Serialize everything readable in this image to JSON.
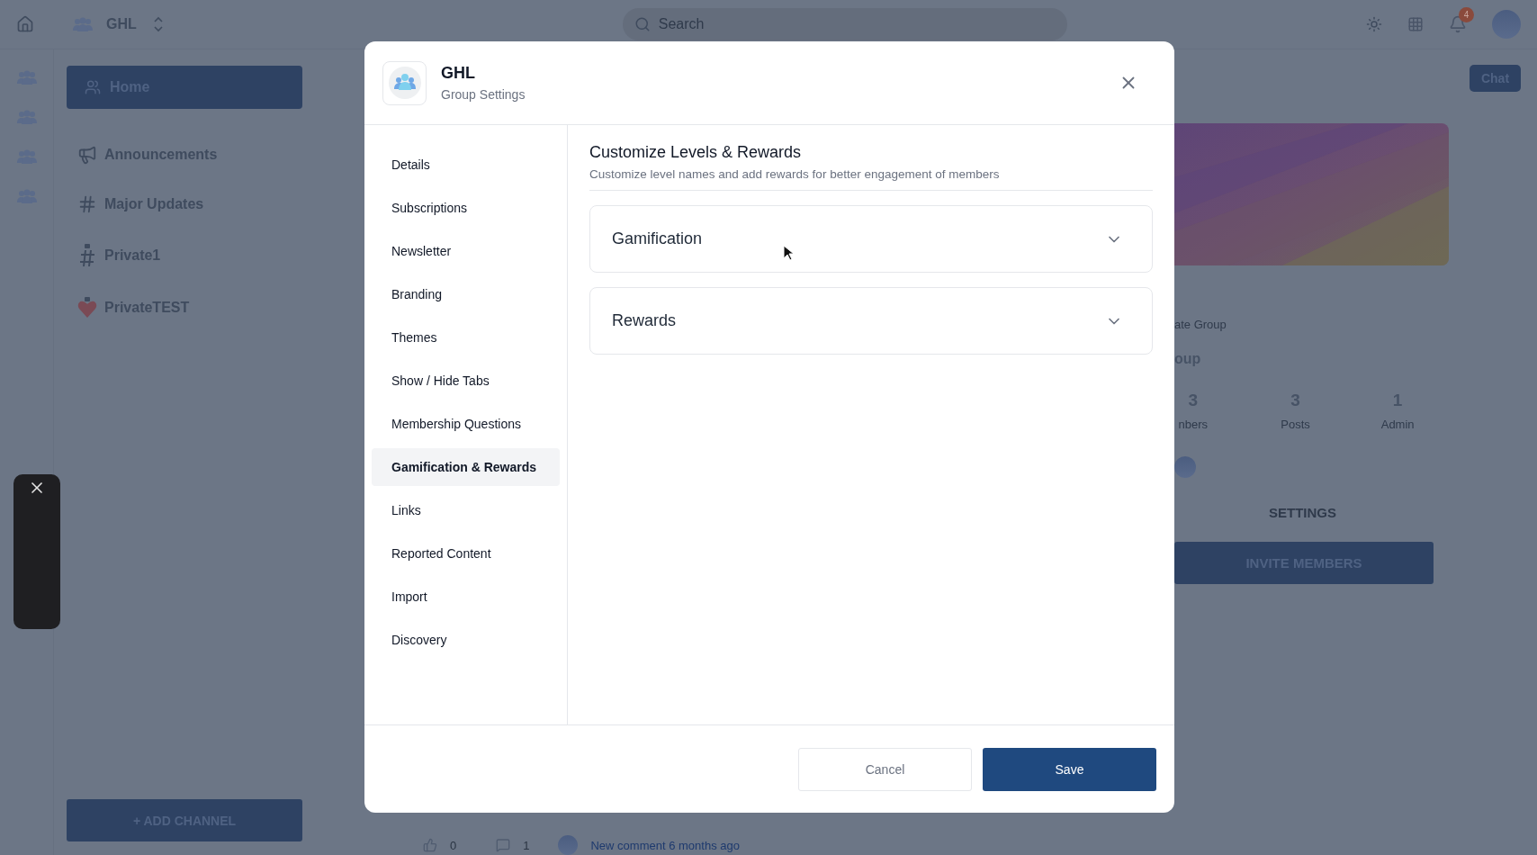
{
  "topbar": {
    "workspace": "GHL",
    "search": {
      "placeholder": "Search"
    },
    "notifications": "4"
  },
  "sidebar": {
    "home": {
      "label": "Home",
      "selected": true
    },
    "channels": [
      {
        "label": "Announcements",
        "kind": "megaphone"
      },
      {
        "label": "Major Updates",
        "kind": "hash"
      },
      {
        "label": "Private1",
        "kind": "private-hash"
      },
      {
        "label": "PrivateTEST",
        "kind": "heart"
      }
    ],
    "add_button": "+ ADD CHANNEL"
  },
  "chat_button": "Chat",
  "group_panel": {
    "type_label": "ate Group",
    "name": "oup",
    "stats": [
      {
        "value": "3",
        "label": "nbers"
      },
      {
        "value": "3",
        "label": "Posts"
      },
      {
        "value": "1",
        "label": "Admin"
      }
    ],
    "settings": "SETTINGS",
    "invite": "INVITE MEMBERS"
  },
  "post_footer": {
    "likes": "0",
    "comments": "1",
    "comment_meta": "New comment 6 months ago"
  },
  "modal": {
    "title": "GHL",
    "subtitle": "Group Settings",
    "nav": [
      {
        "label": "Details",
        "selected": false
      },
      {
        "label": "Subscriptions",
        "selected": false
      },
      {
        "label": "Newsletter",
        "selected": false
      },
      {
        "label": "Branding",
        "selected": false
      },
      {
        "label": "Themes",
        "selected": false
      },
      {
        "label": "Show / Hide Tabs",
        "selected": false
      },
      {
        "label": "Membership Questions",
        "selected": false
      },
      {
        "label": "Gamification & Rewards",
        "selected": true
      },
      {
        "label": "Links",
        "selected": false
      },
      {
        "label": "Reported Content",
        "selected": false
      },
      {
        "label": "Import",
        "selected": false
      },
      {
        "label": "Discovery",
        "selected": false
      }
    ],
    "section_title": "Customize Levels & Rewards",
    "section_subtitle": "Customize level names and add rewards for better engagement of members",
    "accordions": [
      {
        "label": "Gamification",
        "expanded": false
      },
      {
        "label": "Rewards",
        "expanded": false
      }
    ],
    "buttons": {
      "cancel": "Cancel",
      "save": "Save"
    }
  }
}
